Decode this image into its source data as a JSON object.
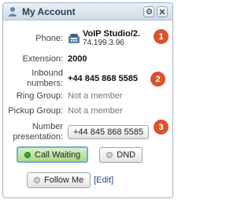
{
  "header": {
    "title": "My Account",
    "user_icon": "user-icon",
    "settings_icon": "gear-icon",
    "close_icon": "close-icon"
  },
  "phone": {
    "label": "Phone:",
    "name": "VoIP Studio/2.",
    "ip": "74.199.3.96",
    "badge": "1"
  },
  "extension": {
    "label": "Extension:",
    "value": "2000"
  },
  "inbound": {
    "label_line1": "Inbound",
    "label_line2": "numbers:",
    "value": "+44 845 868 5585",
    "badge": "2"
  },
  "ring_group": {
    "label": "Ring Group:",
    "value": "Not a member"
  },
  "pickup_group": {
    "label": "Pickup Group:",
    "value": "Not a member"
  },
  "presentation": {
    "label_line1": "Number",
    "label_line2": "presentation:",
    "value": "+44 845 868 5585",
    "badge": "3"
  },
  "buttons": {
    "call_waiting": "Call Waiting",
    "dnd": "DND",
    "follow_me": "Follow Me",
    "edit": "[Edit]"
  },
  "colors": {
    "badge": "#d9532c",
    "status_on": "#2ea82e",
    "status_off": "#cfcfcf",
    "accent_border": "#78a9d6"
  }
}
